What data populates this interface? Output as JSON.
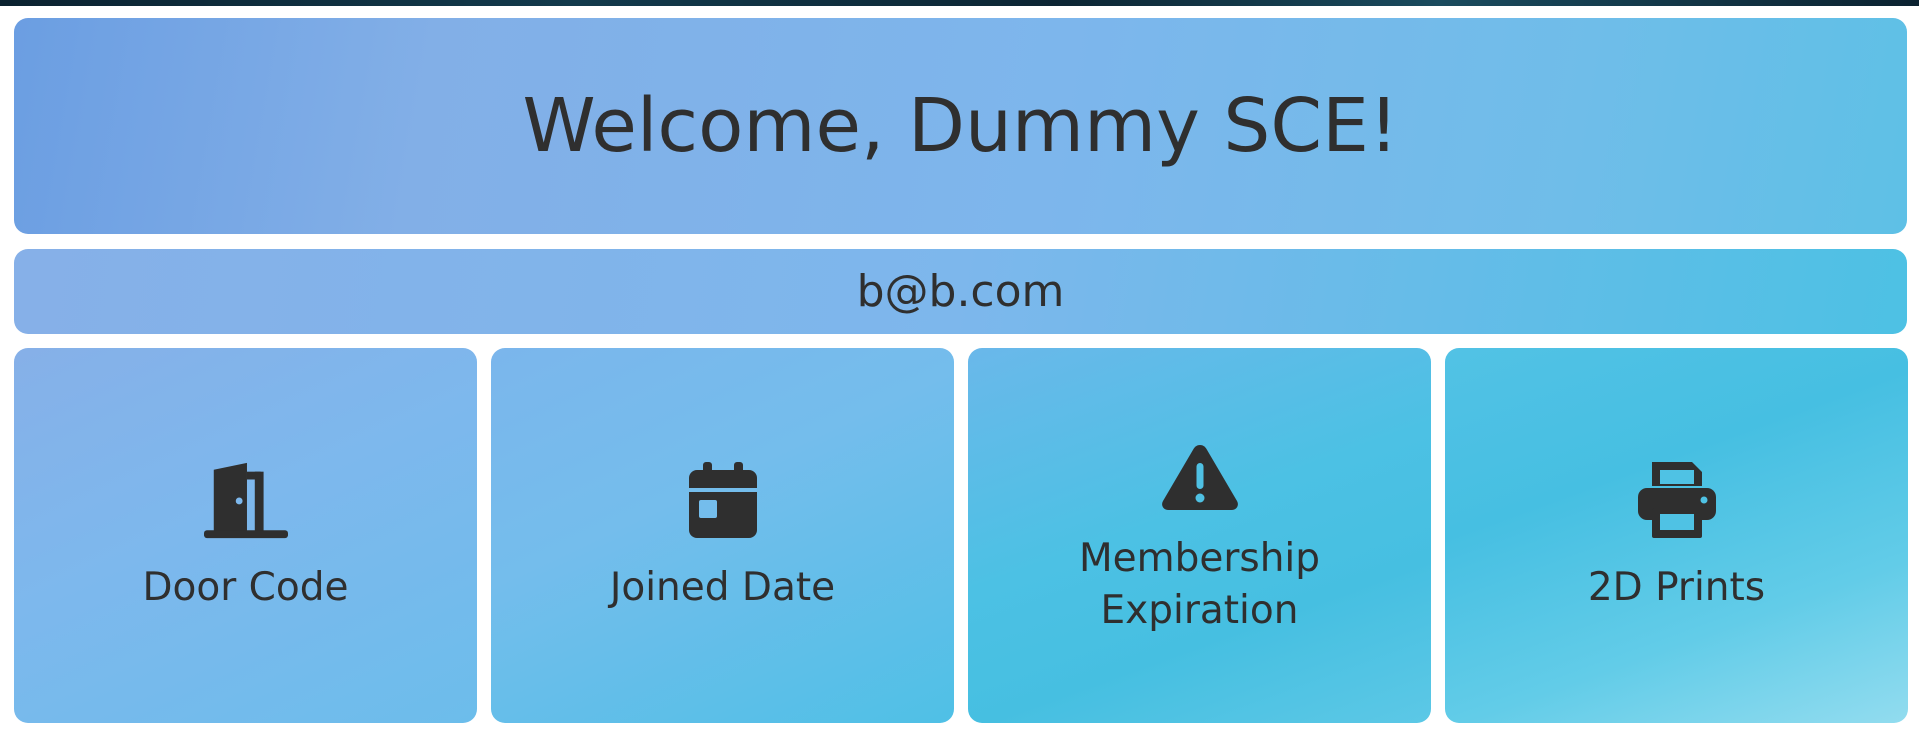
{
  "header": {
    "welcome_text": "Welcome, Dummy SCE!"
  },
  "user": {
    "email": "b@b.com"
  },
  "cards": [
    {
      "label": "Door Code",
      "icon": "door-icon"
    },
    {
      "label": "Joined Date",
      "icon": "calendar-icon"
    },
    {
      "label": "Membership Expiration",
      "icon": "warning-icon"
    },
    {
      "label": "2D Prints",
      "icon": "printer-icon"
    }
  ],
  "colors": {
    "text": "#2f2f2f",
    "gradient_start": "#6b9ee2",
    "gradient_end": "#46bfe2"
  }
}
